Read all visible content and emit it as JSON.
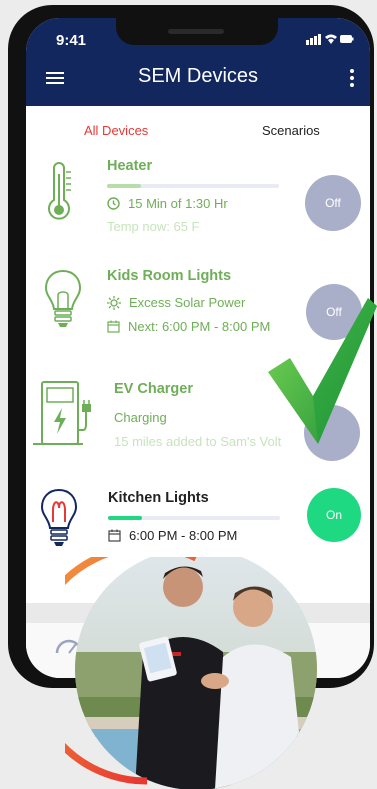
{
  "statusbar": {
    "time": "9:41"
  },
  "appbar": {
    "title": "SEM Devices",
    "menu_icon": "hamburger-icon",
    "more_icon": "kebab-menu-icon",
    "bg": "#13275f"
  },
  "tabs": [
    {
      "label": "All Devices",
      "active": true,
      "color": "#e53935"
    },
    {
      "label": "Scenarios",
      "active": false
    }
  ],
  "devices": [
    {
      "name": "Heater",
      "icon": "thermometer-icon",
      "progress": 0.2,
      "line1": "15 Min of 1:30 Hr",
      "line2": "Temp now: 65 F",
      "toggle": "Off"
    },
    {
      "name": "Kids Room Lights",
      "icon": "lightbulb-icon",
      "line1": "Excess Solar Power",
      "line2": "Next: 6:00 PM - 8:00 PM",
      "toggle": "Off"
    },
    {
      "name": "EV Charger",
      "icon": "ev-charger-icon",
      "line1": "Charging",
      "line2": "15 miles added to Sam's Volt",
      "toggle": ""
    },
    {
      "name": "Kitchen Lights",
      "icon": "lightbulb-on-icon",
      "progress": 0.2,
      "line1": "6:00 PM - 8:00 PM",
      "toggle": "On"
    }
  ],
  "colors": {
    "accent_green": "#6fae58",
    "toggle_off": "#a9afc9",
    "toggle_on": "#1fd882",
    "checkmark": "#27b24a"
  }
}
